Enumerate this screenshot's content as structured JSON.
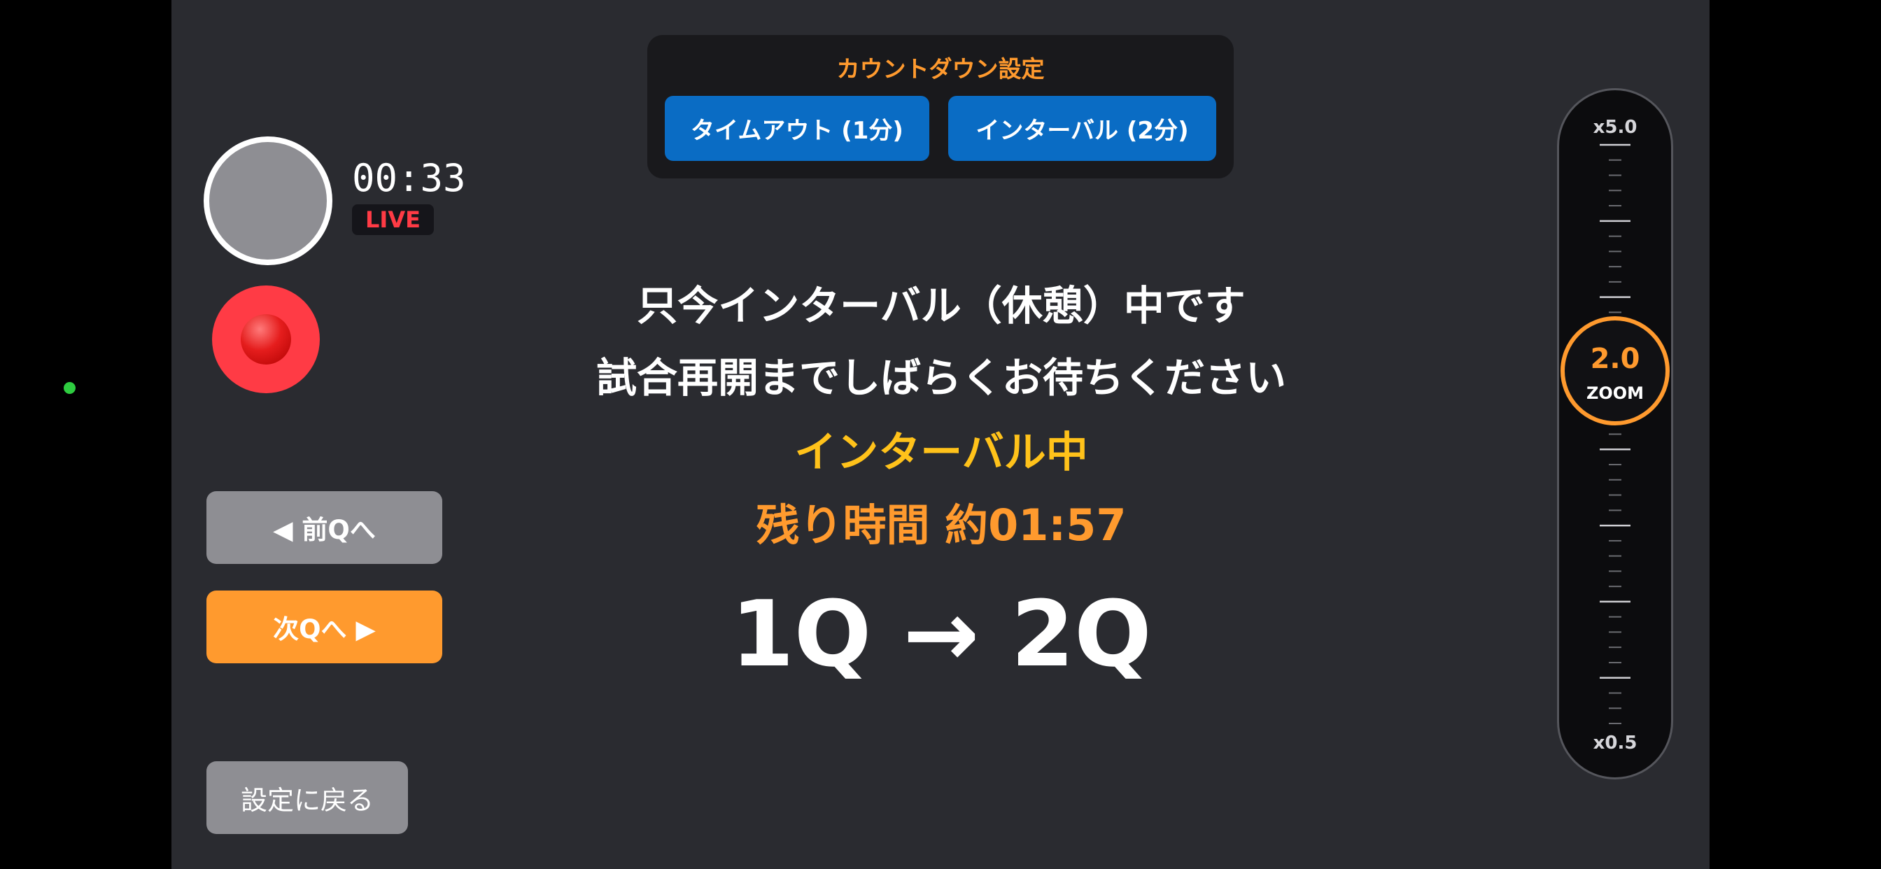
{
  "countdown": {
    "title": "カウントダウン設定",
    "timeout_label": "タイムアウト (1分)",
    "interval_label": "インターバル (2分)"
  },
  "recording": {
    "timer": "00:33",
    "live_label": "LIVE"
  },
  "navigation": {
    "prev_label": "◀ 前Qへ",
    "next_label": "次Qへ ▶",
    "back_label": "設定に戻る"
  },
  "message": {
    "line1": "只今インターバル（休憩）中です",
    "line2": "試合再開までしばらくお待ちください",
    "status": "インターバル中",
    "remaining": "残り時間 約01:57",
    "quarter_transition": "1Q → 2Q"
  },
  "zoom": {
    "max_label": "x5.0",
    "min_label": "x0.5",
    "value_label": "2.0",
    "unit_label": "ZOOM",
    "min": 0.5,
    "max": 5.0,
    "value": 2.0
  },
  "colors": {
    "background": "#2a2b30",
    "accent_orange": "#ff9a2e",
    "status_yellow": "#ffc21a",
    "button_blue": "#0a6cc4",
    "record_red": "#ff3b45",
    "live_red": "#ff3b45",
    "status_dot_green": "#2ecc40"
  }
}
